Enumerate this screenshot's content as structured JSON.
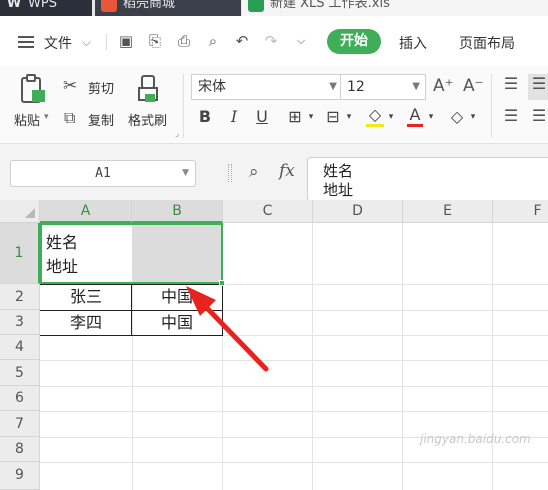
{
  "tabs": [
    {
      "label": "WPS",
      "icon": "wps-logo-icon"
    },
    {
      "label": "稻壳商城",
      "icon": "docer-icon"
    },
    {
      "label": "新建 XLS 工作表.xls",
      "icon": "spreadsheet-icon"
    }
  ],
  "menu": {
    "file_label": "文件",
    "start_label": "开始",
    "insert_label": "插入",
    "layout_label": "页面布局"
  },
  "ribbon": {
    "paste_label": "粘贴",
    "cut_label": "剪切",
    "copy_label": "复制",
    "format_painter_label": "格式刷",
    "font_name": "宋体",
    "font_size": "12",
    "grow_font": "A⁺",
    "shrink_font": "A⁻"
  },
  "formula_bar": {
    "cell_ref": "A1",
    "fx_label": "fx",
    "content_line1": "姓名",
    "content_line2": "地址"
  },
  "sheet": {
    "columns": [
      "A",
      "B",
      "C",
      "D",
      "E",
      "F"
    ],
    "rows": [
      "1",
      "2",
      "3",
      "4",
      "5",
      "6",
      "7",
      "8",
      "9"
    ],
    "cells": {
      "A1_line1": "姓名",
      "A1_line2": "地址",
      "A2": "张三",
      "B2": "中国",
      "A3": "李四",
      "B3": "中国"
    },
    "selected_range": "A1:B1",
    "accent_color": "#3fae58",
    "arrow_color": "#e8231e"
  },
  "watermark": "jingyan.baidu.com"
}
